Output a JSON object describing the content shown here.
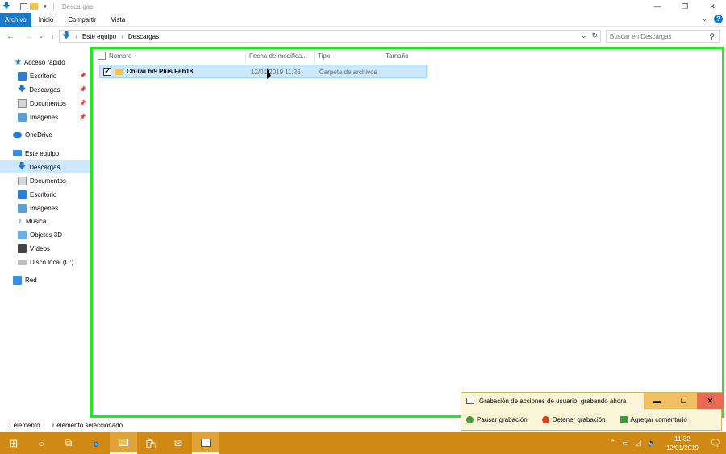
{
  "window": {
    "title": "Descargas"
  },
  "ribbon": {
    "tabs": [
      "Archivo",
      "Inicio",
      "Compartir",
      "Vista"
    ]
  },
  "address": {
    "crumbs": [
      "Este equipo",
      "Descargas"
    ]
  },
  "search": {
    "placeholder": "Buscar en Descargas"
  },
  "nav": {
    "items": [
      {
        "label": "Acceso rápido",
        "icon": "star-icon"
      },
      {
        "label": "Escritorio",
        "icon": "desktop-icon",
        "pinned": true
      },
      {
        "label": "Descargas",
        "icon": "download-icon",
        "pinned": true
      },
      {
        "label": "Documentos",
        "icon": "documents-icon",
        "pinned": true
      },
      {
        "label": "Imágenes",
        "icon": "pictures-icon",
        "pinned": true
      },
      {
        "label": "OneDrive",
        "icon": "cloud-icon"
      },
      {
        "label": "Este equipo",
        "icon": "computer-icon"
      },
      {
        "label": "Descargas",
        "icon": "download-icon",
        "selected": true
      },
      {
        "label": "Documentos",
        "icon": "documents-icon"
      },
      {
        "label": "Escritorio",
        "icon": "desktop-icon"
      },
      {
        "label": "Imágenes",
        "icon": "pictures-icon"
      },
      {
        "label": "Música",
        "icon": "music-icon"
      },
      {
        "label": "Objetos 3D",
        "icon": "cube-icon"
      },
      {
        "label": "Vídeos",
        "icon": "video-icon"
      },
      {
        "label": "Disco local (C:)",
        "icon": "drive-icon"
      },
      {
        "label": "Red",
        "icon": "network-icon"
      }
    ]
  },
  "columns": [
    "Nombre",
    "Fecha de modifica...",
    "Tipo",
    "Tamaño"
  ],
  "files": [
    {
      "name": "Chuwi hi9 Plus Feb18",
      "modified": "12/01/2019 11:26",
      "type": "Carpeta de archivos",
      "size": ""
    }
  ],
  "status": {
    "count": "1 elemento",
    "selected": "1 elemento seleccionado"
  },
  "recorder": {
    "title": "Grabación de acciones de usuario: grabando ahora",
    "actions": [
      "Pausar grabación",
      "Detener grabación",
      "Agregar comentario"
    ]
  },
  "taskbar": {
    "time": "11:32",
    "date": "12/01/2019"
  }
}
